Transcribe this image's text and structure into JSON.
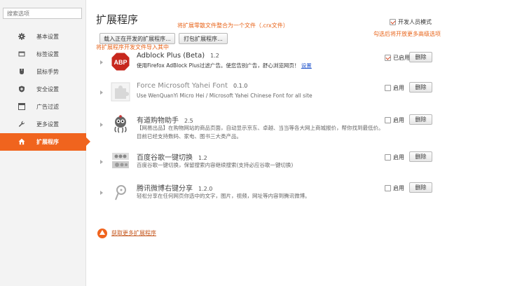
{
  "sidebar": {
    "search_placeholder": "搜索选项",
    "items": [
      {
        "label": "基本设置",
        "icon": "gear-icon"
      },
      {
        "label": "标签设置",
        "icon": "tab-icon"
      },
      {
        "label": "鼠标手势",
        "icon": "mouse-gesture-icon"
      },
      {
        "label": "安全设置",
        "icon": "shield-icon"
      },
      {
        "label": "广告过滤",
        "icon": "filter-window-icon"
      },
      {
        "label": "更多设置",
        "icon": "wrench-icon"
      },
      {
        "label": "扩展程序",
        "icon": "home-icon",
        "active": true
      }
    ]
  },
  "page": {
    "title": "扩展程序",
    "load_unpacked_label": "载入正在开发的扩展程序...",
    "pack_label": "打包扩展程序...",
    "dev_mode_label": "开发人员模式",
    "dev_mode_checked": true,
    "more_link": "获取更多扩展程序"
  },
  "annotations": {
    "pack_note": "将扩展零散文件整合为一个文件（.crx文件）",
    "dev_note": "勾选后将开放更多高级选项",
    "load_note": "将扩展程序开发文件导入其中"
  },
  "extensions": [
    {
      "name": "Adblock Plus (Beta)",
      "version": "1.2",
      "desc": "使用Firefox AdBlock Plus过滤广告。使您告别广告，舒心浏览网页！",
      "link": "设置",
      "enabled": true,
      "enable_label": "已启用",
      "delete_label": "删除",
      "icon": "adblock-plus-icon"
    },
    {
      "name": "Force Microsoft Yahei Font",
      "version": "0.1.0",
      "desc": "Use WenQuanYi Micro Hei / Microsoft Yahei Chinese Font for all site",
      "enabled": false,
      "enable_label": "启用",
      "delete_label": "删除",
      "icon": "puzzle-icon"
    },
    {
      "name": "有道购物助手",
      "version": "2.5",
      "desc": "【网易出品】在购物网站的商品页面，自动显示京东、卓越、当当等各大网上商城报价，帮你找到最低价。目前已经支持数码、家电、图书三大类产品。",
      "enabled": false,
      "enable_label": "启用",
      "delete_label": "删除",
      "icon": "youdao-octopus-icon"
    },
    {
      "name": "百度谷歌一键切换",
      "version": "1.2",
      "desc": "百度谷歌一键切换，保留搜索内容继续搜索(支持必应谷歌一键切换)",
      "enabled": false,
      "enable_label": "启用",
      "delete_label": "删除",
      "icon": "baidu-google-icon"
    },
    {
      "name": "腾讯微博右键分享",
      "version": "1.2.0",
      "desc": "轻松分享在任何网页你选中的文字，图片，视频，网址等内容到腾讯微博。",
      "enabled": false,
      "enable_label": "启用",
      "delete_label": "删除",
      "icon": "tencent-weibo-icon"
    }
  ],
  "colors": {
    "accent": "#f0641e",
    "note": "#e8641a",
    "link": "#2255cc"
  }
}
